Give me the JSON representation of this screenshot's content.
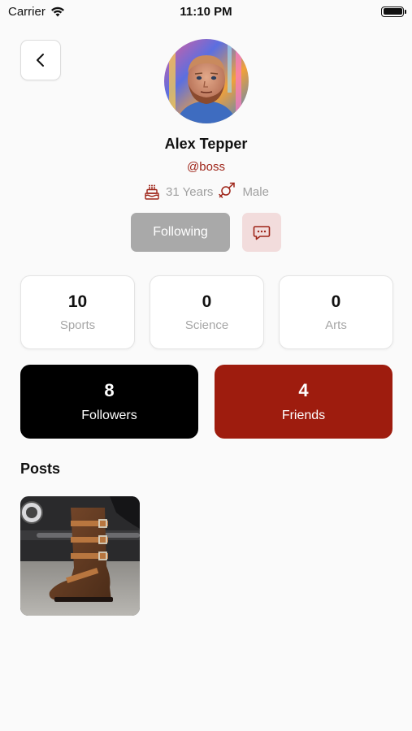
{
  "status_bar": {
    "carrier": "Carrier",
    "time": "11:10 PM"
  },
  "profile": {
    "name": "Alex Tepper",
    "handle": "@boss",
    "age": "31 Years",
    "gender": "Male"
  },
  "actions": {
    "following_label": "Following"
  },
  "stats": [
    {
      "value": "10",
      "label": "Sports"
    },
    {
      "value": "0",
      "label": "Science"
    },
    {
      "value": "0",
      "label": "Arts"
    }
  ],
  "social": {
    "followers": {
      "value": "8",
      "label": "Followers",
      "color": "#000000"
    },
    "friends": {
      "value": "4",
      "label": "Friends",
      "color": "#9e1c0e"
    }
  },
  "posts": {
    "title": "Posts"
  },
  "colors": {
    "accent": "#9e2418",
    "following_bg": "#a9a9a9",
    "message_bg": "#f2dcdc"
  }
}
